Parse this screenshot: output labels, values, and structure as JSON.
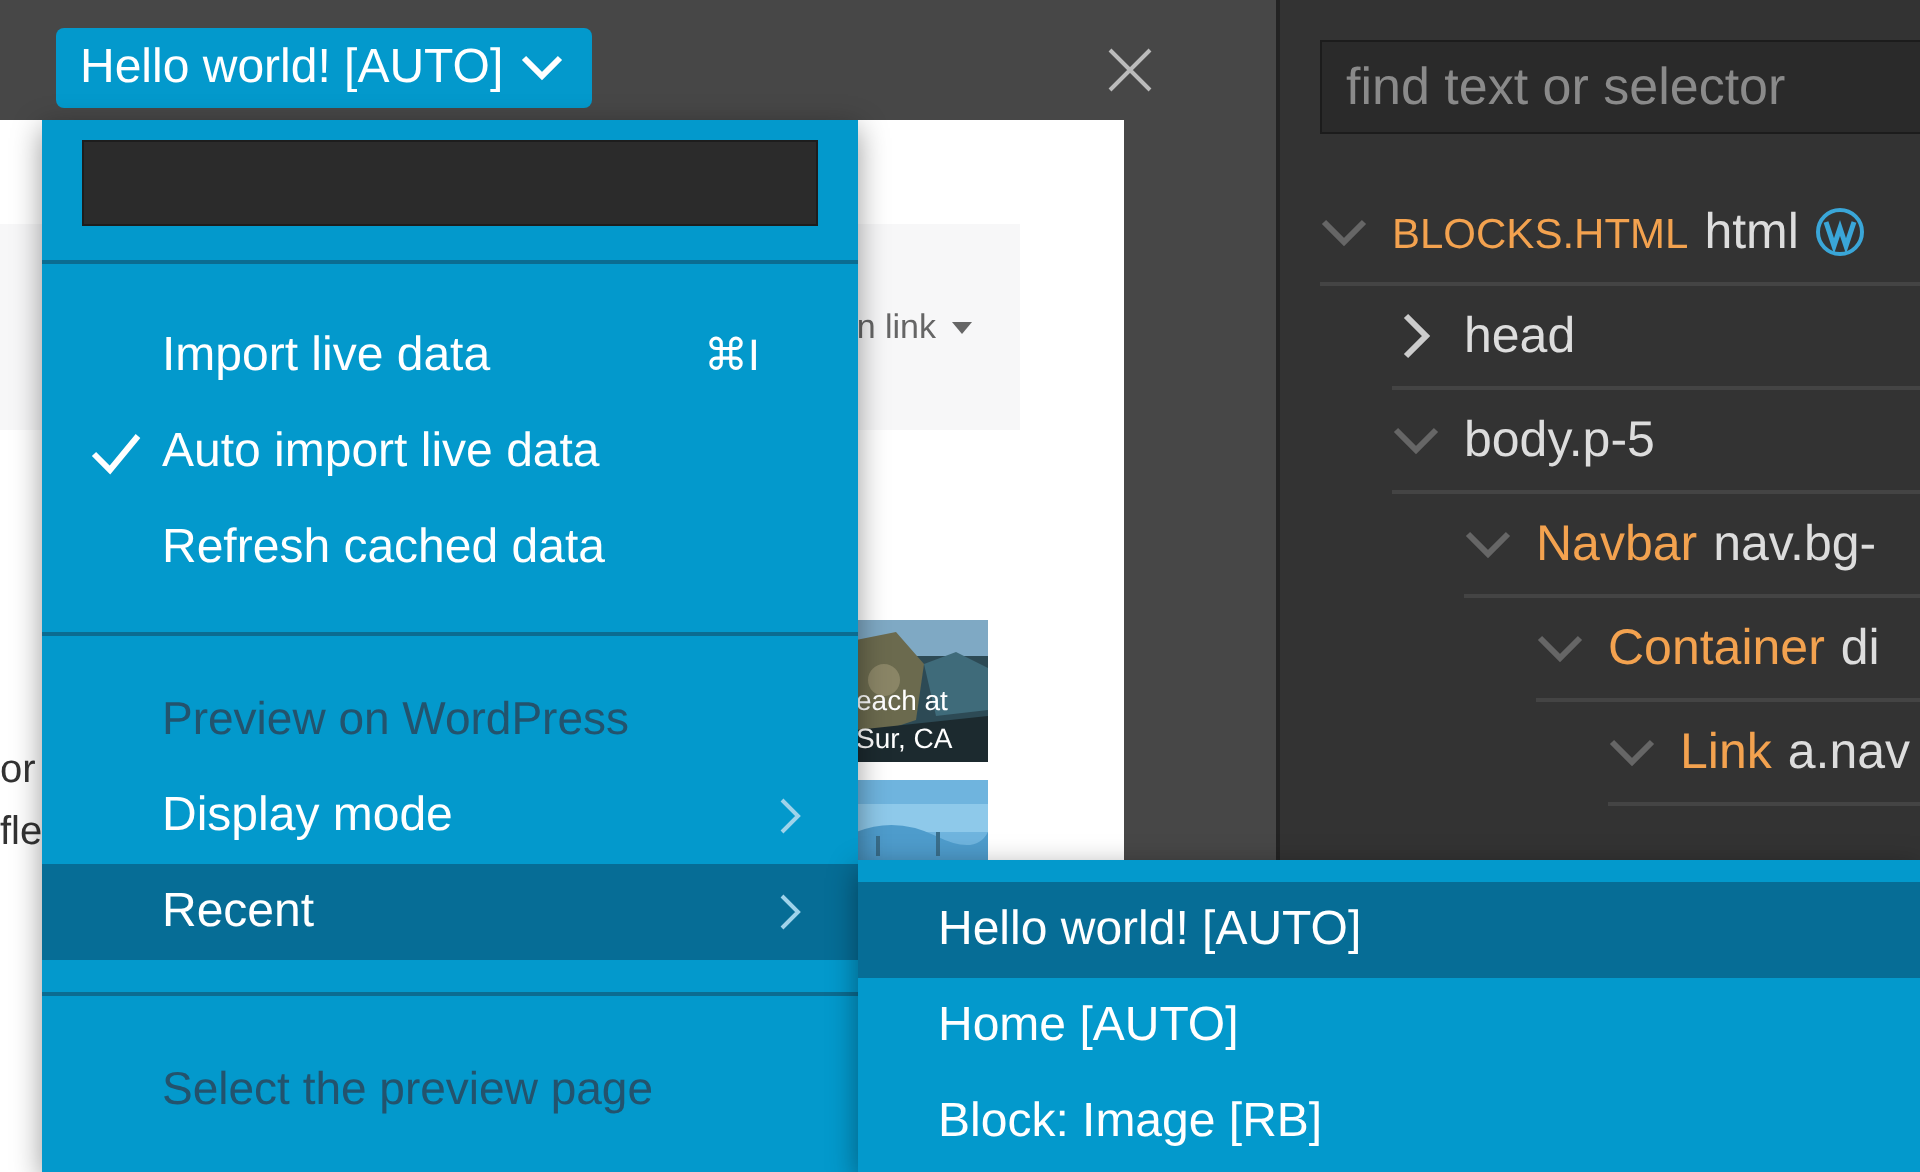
{
  "preview": {
    "page_button": "Hello world! [AUTO]",
    "nav_link": "n link",
    "text_lines": [
      "or",
      "fle"
    ],
    "caption_lines": [
      "each at",
      "Sur, CA"
    ]
  },
  "menu": {
    "sections": [
      {
        "items": [
          {
            "label": "Import live data",
            "shortcut": "⌘I",
            "checked": false
          },
          {
            "label": "Auto import live data",
            "checked": true
          },
          {
            "label": "Refresh cached data",
            "checked": false
          }
        ]
      },
      {
        "heading": "Preview on WordPress",
        "items": [
          {
            "label": "Display mode",
            "submenu": true,
            "selected": false
          },
          {
            "label": "Recent",
            "submenu": true,
            "selected": true
          }
        ]
      },
      {
        "heading": "Select the preview page"
      }
    ]
  },
  "submenu": {
    "items": [
      {
        "label": "Hello world! [AUTO]",
        "selected": true
      },
      {
        "label": "Home [AUTO]",
        "selected": false
      },
      {
        "label": "Block: Image [RB]",
        "selected": false
      }
    ]
  },
  "inspector": {
    "search": {
      "placeholder": "find text or selector"
    },
    "tree": [
      {
        "component": "BLOCKS.HTML",
        "tag": "html",
        "expanded": true,
        "children": [
          {
            "tag": "head",
            "expanded": false
          },
          {
            "tag": "body.p-5",
            "expanded": true,
            "children": [
              {
                "component": "Navbar",
                "tag": "nav.bg-",
                "expanded": true,
                "children": [
                  {
                    "component": "Container",
                    "tag": "di",
                    "expanded": true,
                    "children": [
                      {
                        "component": "Link",
                        "tag": "a.nav",
                        "expanded": true
                      }
                    ]
                  }
                ]
              }
            ]
          }
        ]
      }
    ]
  }
}
